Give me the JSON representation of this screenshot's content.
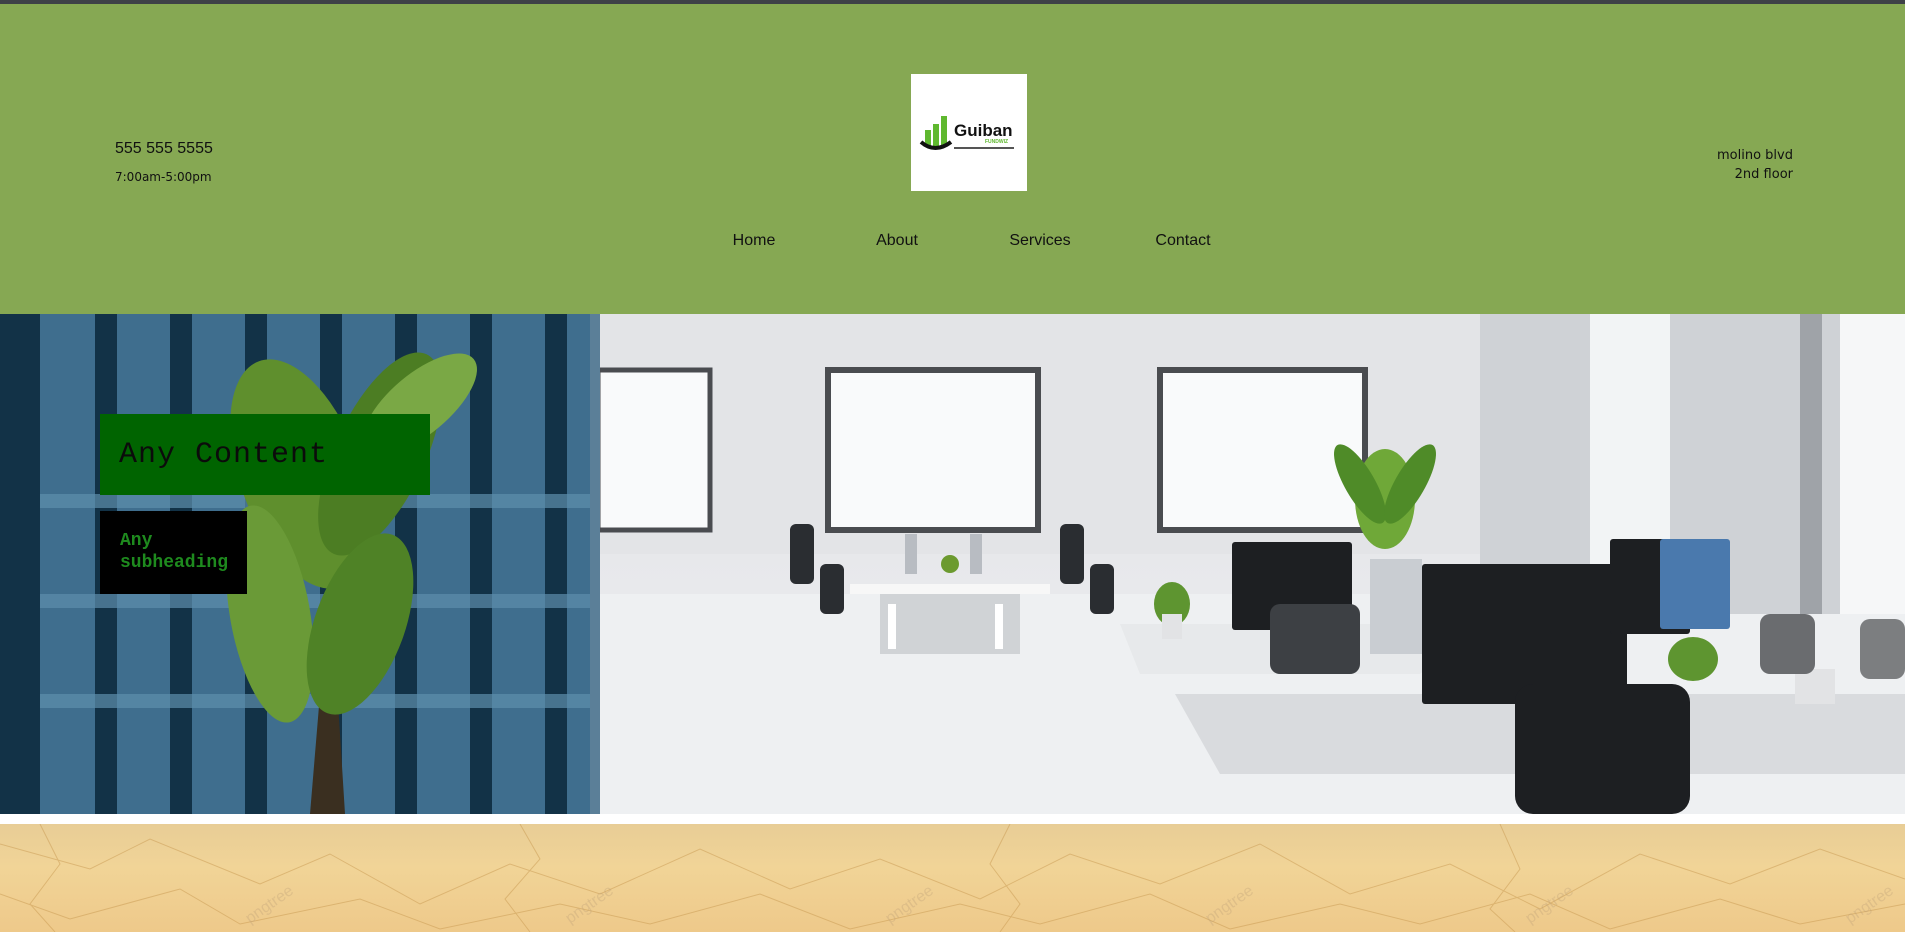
{
  "header": {
    "phone": "555 555 5555",
    "hours": "7:00am-5:00pm",
    "address_line1": "molino blvd",
    "address_line2": "2nd floor",
    "logo": {
      "name": "Guiban",
      "subname": "FUNDWIZ"
    }
  },
  "nav": {
    "items": [
      {
        "label": "Home"
      },
      {
        "label": "About"
      },
      {
        "label": "Services"
      },
      {
        "label": "Contact"
      }
    ]
  },
  "hero": {
    "title": "Any Content",
    "subheading": "Any subheading"
  },
  "colors": {
    "header_bg": "#86a853",
    "title_box": "#006400",
    "subheading_box": "#000000",
    "subheading_text": "#1e8a1e"
  }
}
